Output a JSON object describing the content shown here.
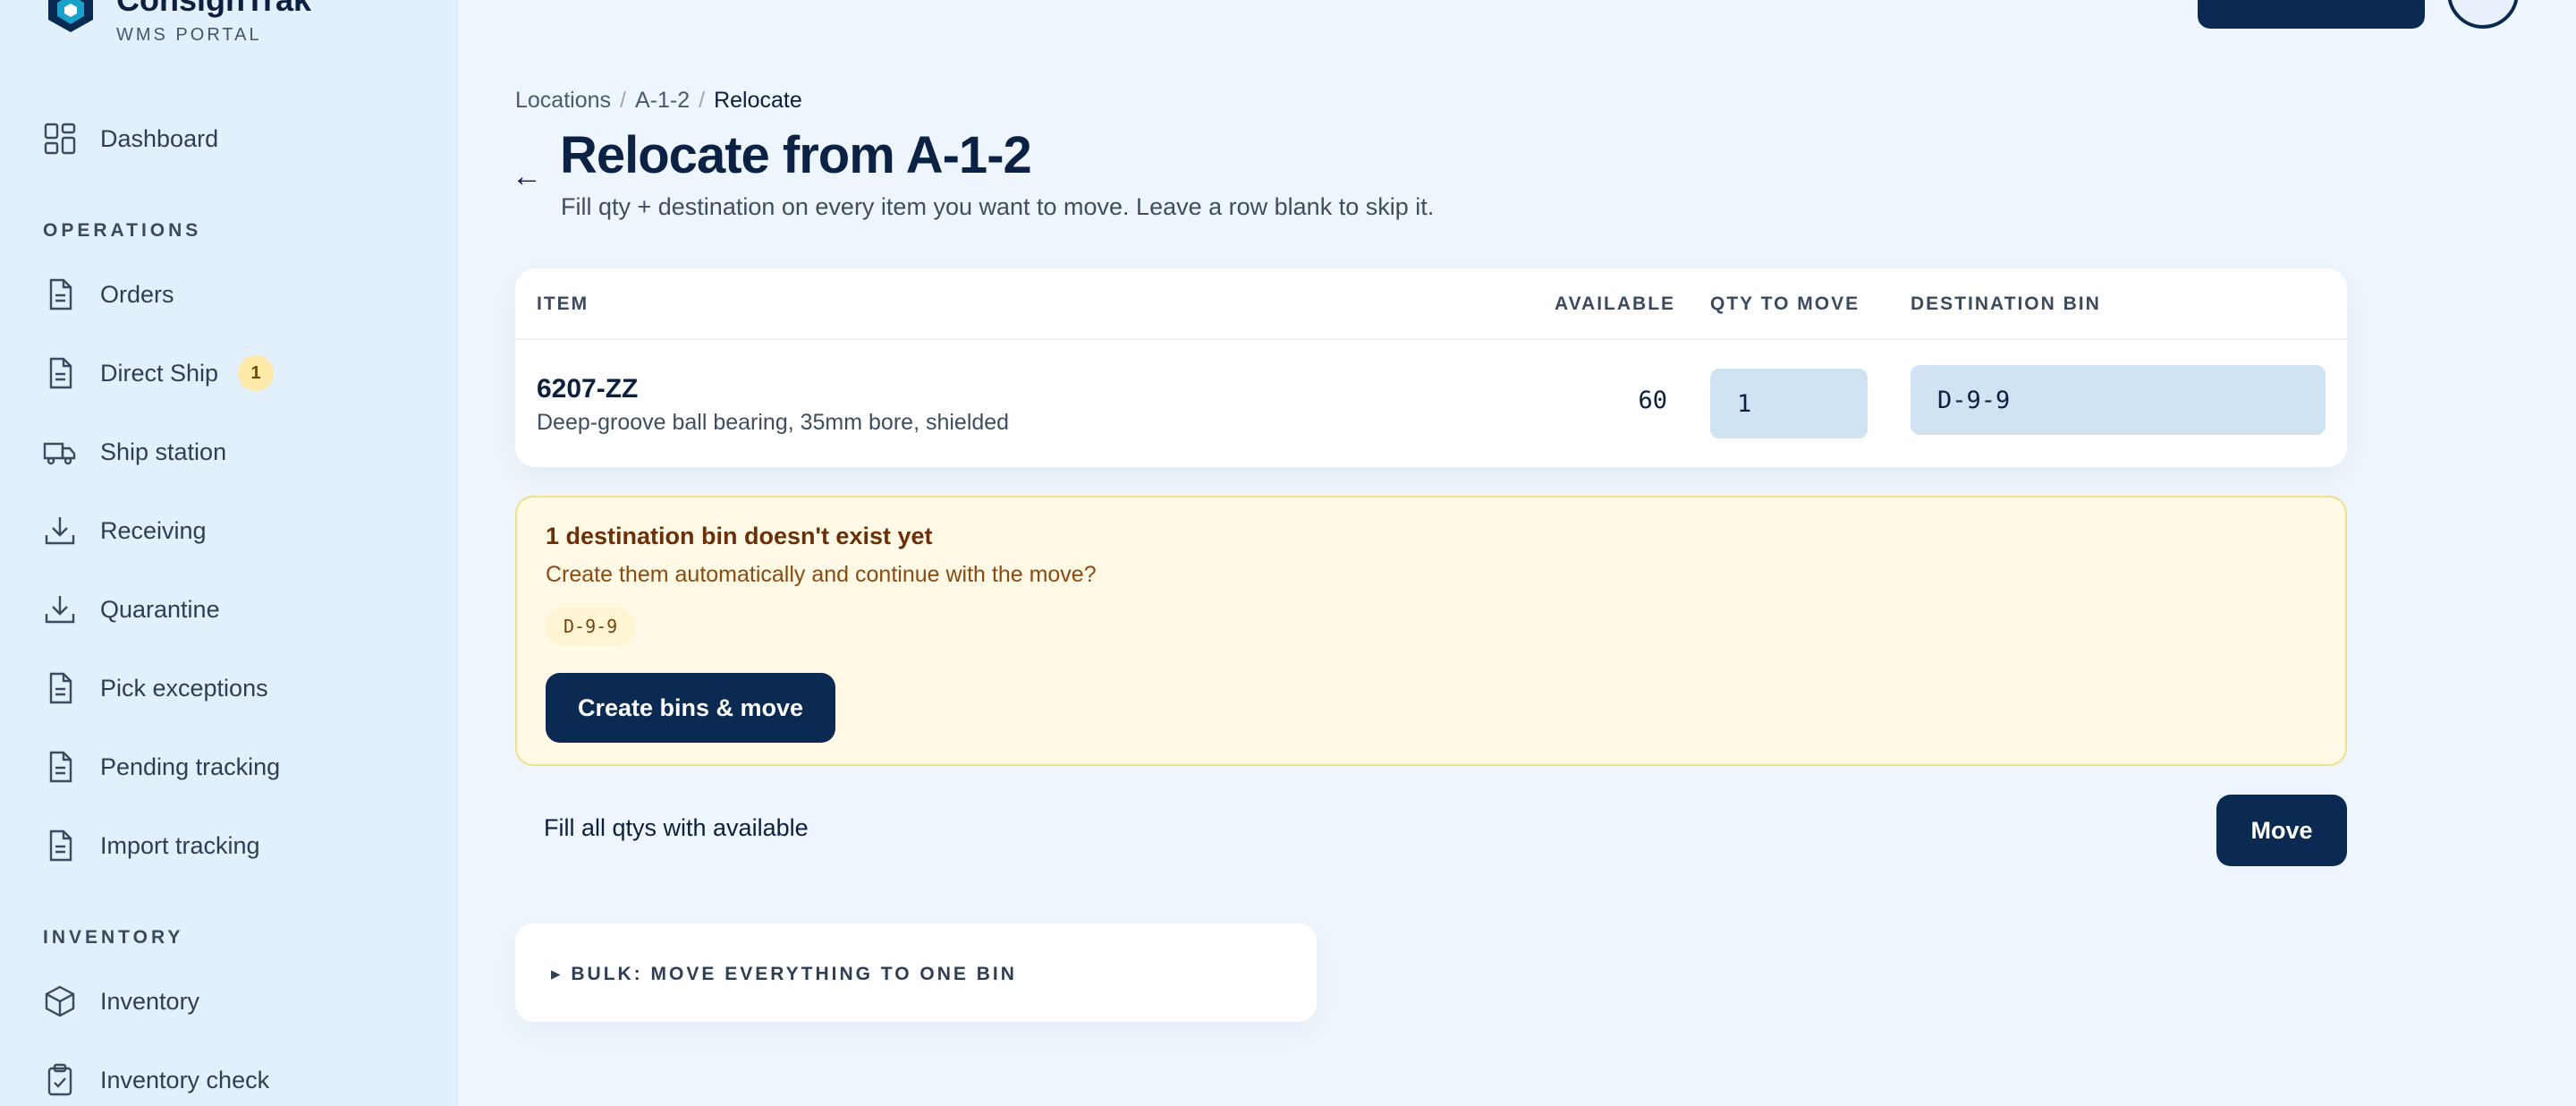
{
  "brand": {
    "name": "ConsignTrak",
    "subtitle": "WMS PORTAL"
  },
  "sidebar": {
    "top_items": [
      {
        "label": "Dashboard",
        "icon": "dashboard-icon"
      }
    ],
    "operations_heading": "OPERATIONS",
    "operations": [
      {
        "label": "Orders",
        "icon": "document-icon"
      },
      {
        "label": "Direct Ship",
        "icon": "document-icon",
        "badge": "1"
      },
      {
        "label": "Ship station",
        "icon": "truck-icon"
      },
      {
        "label": "Receiving",
        "icon": "download-icon"
      },
      {
        "label": "Quarantine",
        "icon": "download-icon"
      },
      {
        "label": "Pick exceptions",
        "icon": "document-icon"
      },
      {
        "label": "Pending tracking",
        "icon": "document-icon"
      },
      {
        "label": "Import tracking",
        "icon": "document-icon"
      }
    ],
    "inventory_heading": "INVENTORY",
    "inventory": [
      {
        "label": "Inventory",
        "icon": "box-icon"
      },
      {
        "label": "Inventory check",
        "icon": "clipboard-check-icon"
      }
    ]
  },
  "breadcrumb": {
    "root": "Locations",
    "location": "A-1-2",
    "current": "Relocate"
  },
  "page": {
    "title": "Relocate from A-1-2",
    "subtitle": "Fill qty + destination on every item you want to move. Leave a row blank to skip it."
  },
  "table": {
    "headers": {
      "item": "ITEM",
      "available": "AVAILABLE",
      "qty": "QTY TO MOVE",
      "destination": "DESTINATION BIN"
    },
    "rows": [
      {
        "code": "6207-ZZ",
        "description": "Deep-groove ball bearing, 35mm bore, shielded",
        "available": "60",
        "qty": "1",
        "destination": "D-9-9"
      }
    ]
  },
  "warning": {
    "title": "1 destination bin doesn't exist yet",
    "text": "Create them automatically and continue with the move?",
    "bins": [
      "D-9-9"
    ],
    "button": "Create bins & move"
  },
  "actions": {
    "fill_all": "Fill all qtys with available",
    "move": "Move"
  },
  "bulk": {
    "label": "▸ BULK: MOVE EVERYTHING TO ONE BIN"
  },
  "colors": {
    "primary": "#0b2a52",
    "warning_bg": "#fff9e5",
    "warning_border": "#f2e08a",
    "sidebar_bg": "#e1f0fb",
    "input_bg": "#cfe3f3"
  }
}
